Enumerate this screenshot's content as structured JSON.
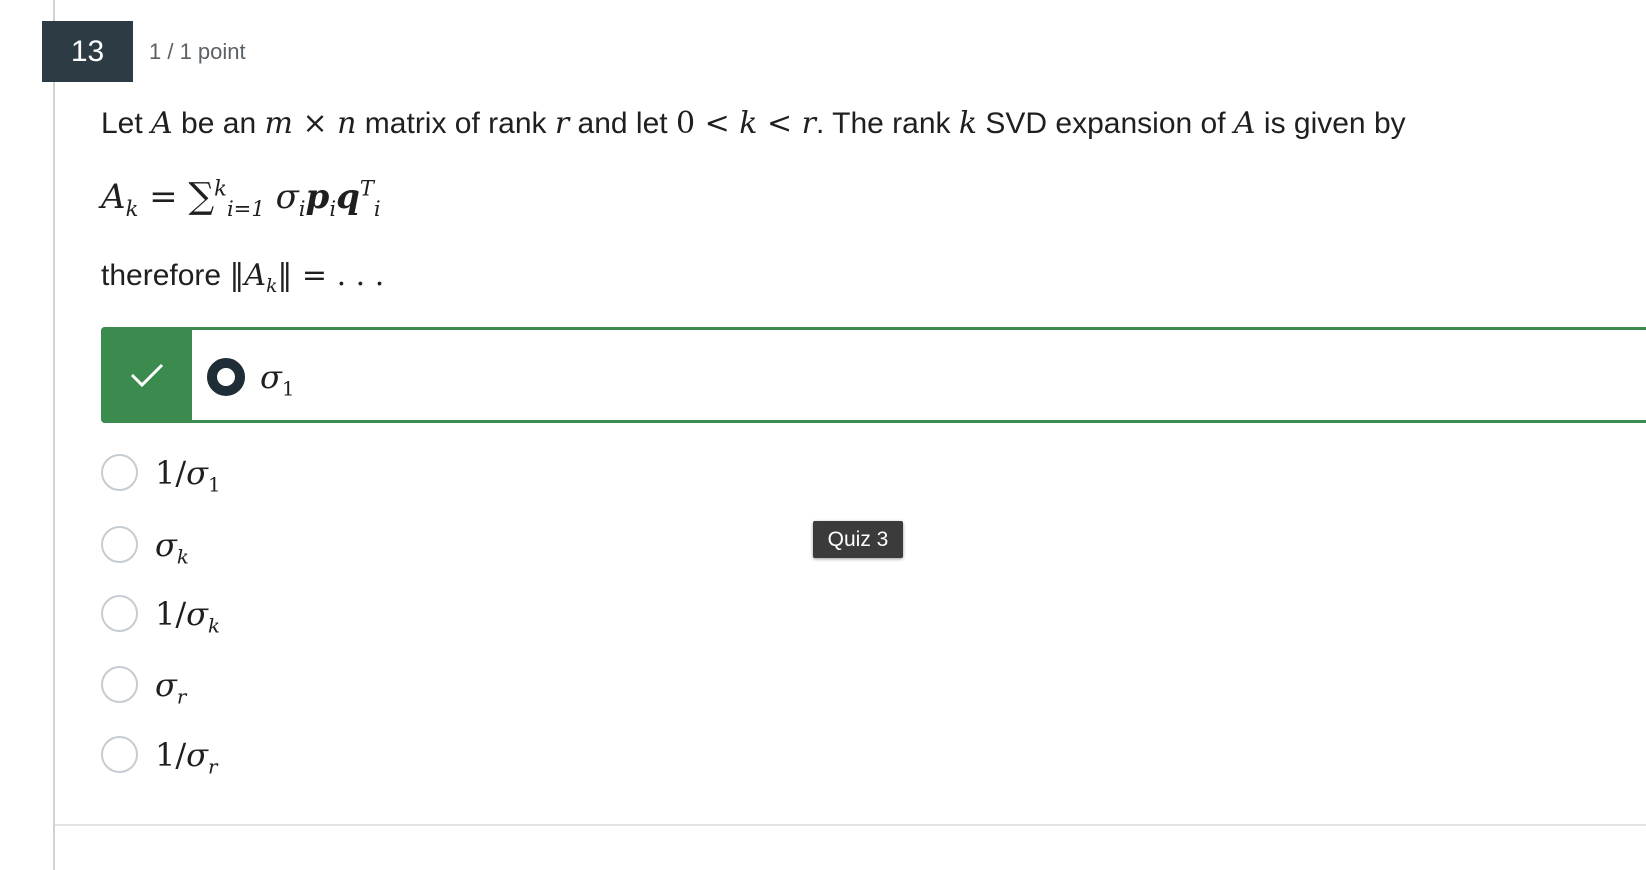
{
  "question": {
    "number": "13",
    "points": "1 / 1 point",
    "prompt": {
      "t1": "Let ",
      "A": "A",
      "t2": " be an ",
      "m": "m",
      "times": " × ",
      "n": "n",
      "t3": " matrix of rank ",
      "r": "r",
      "t4": " and let ",
      "zero": "0",
      "lt1": " < ",
      "k": "k",
      "lt2": " < ",
      "r2": "r",
      "t5": ". The rank ",
      "k2": "k",
      "t6": " SVD expansion of ",
      "A2": "A",
      "t7": " is given by"
    },
    "formula": {
      "A": "A",
      "k_sub": "k",
      "eq": " = ",
      "sum": "∑",
      "sum_sup": "k",
      "sum_sub": "i=1",
      "sigma": " σ",
      "sigma_sub": "i",
      "p": "p",
      "p_sub": "i",
      "q": "q",
      "q_sup": "T",
      "q_sub": "i"
    },
    "therefore": {
      "word": "therefore ",
      "open": "‖",
      "A": "A",
      "k_sub": "k",
      "close": "‖",
      "rest": " = . . ."
    }
  },
  "answers": [
    {
      "state": "correct-selected",
      "base": "σ",
      "sub": "1",
      "prefix": ""
    },
    {
      "state": "unselected",
      "prefix": "1/",
      "base": "σ",
      "sub": "1"
    },
    {
      "state": "unselected",
      "prefix": "",
      "base": "σ",
      "sub": "k"
    },
    {
      "state": "unselected",
      "prefix": "1/",
      "base": "σ",
      "sub": "k"
    },
    {
      "state": "unselected",
      "prefix": "",
      "base": "σ",
      "sub": "r"
    },
    {
      "state": "unselected",
      "prefix": "1/",
      "base": "σ",
      "sub": "r"
    }
  ],
  "tooltip": "Quiz 3",
  "icons": {
    "correct": "checkmark-icon",
    "selected": "radio-selected-icon"
  },
  "colors": {
    "correct": "#3b8a4e",
    "header": "#2d3b45"
  }
}
